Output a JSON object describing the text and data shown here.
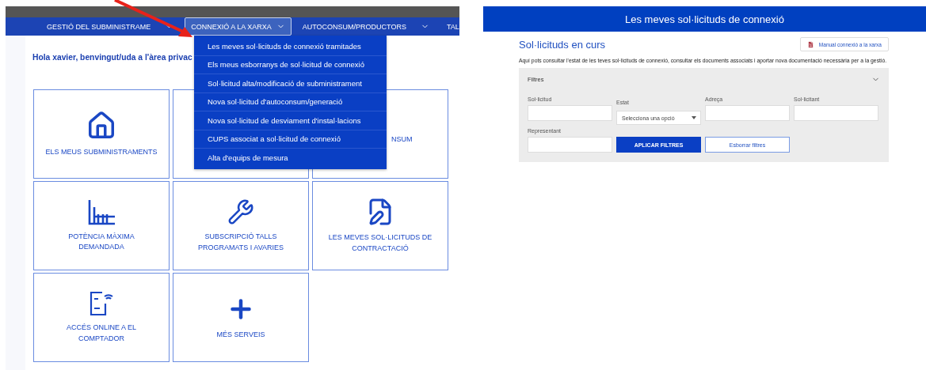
{
  "left_portal": {
    "nav": {
      "items": [
        {
          "label": "GESTIÓ DEL SUBMINISTRAME",
          "selected": false,
          "caret": true
        },
        {
          "label": "CONNEXIÓ A LA XARXA",
          "selected": true,
          "caret": true
        },
        {
          "label": "AUTOCONSUM/PRODUCTORS",
          "selected": false,
          "caret": true
        },
        {
          "label": "TAL",
          "selected": false,
          "caret": false
        }
      ]
    },
    "dropdown": {
      "items": [
        "Les meves sol·licituds de connexió tramitades",
        "Els meus esborranys de sol·licitud de connexió",
        "Sol·licitud alta/modificació de subministrament",
        "Nova sol·licitud d'autoconsum/generació",
        "Nova sol·licitud de desviament d'instal·lacions",
        "CUPS associat a sol·licitud de connexió",
        "Alta d'equips de mesura"
      ]
    },
    "greeting": "Hola xavier, benvingut/uda a l'àrea privac",
    "tiles": [
      {
        "kind": "full",
        "label": "ELS MEUS SUBMINISTRAMENTS"
      },
      {
        "kind": "covered"
      },
      {
        "kind": "partial",
        "label": "NSUM"
      },
      {
        "kind": "full",
        "label": "POTÈNCIA MÀXIMA DEMANDADA"
      },
      {
        "kind": "full",
        "label": "SUBSCRIPCIÓ TALLS PROGRAMATS I AVARIES"
      },
      {
        "kind": "full",
        "label": "LES MEVES SOL·LICITUDS DE CONTRACTACIÓ"
      },
      {
        "kind": "full",
        "label": "ACCÉS ONLINE A EL COMPTADOR"
      },
      {
        "kind": "full",
        "label": "MÉS SERVEIS"
      }
    ]
  },
  "right_page": {
    "header": "Les meves sol·licituds de connexió",
    "title": "Sol·licituds en curs",
    "manual_button": "Manual connexió a la xarxa",
    "description": "Aquí pots consultar l'estat de les teves sol·licituds de connexió, consultar els documents associats i aportar nova documentació necessària per a la gestió.",
    "filters": {
      "title": "Filtres",
      "expanded": true,
      "fields": [
        {
          "kind": "input",
          "label": "Sol·licitud"
        },
        {
          "kind": "select",
          "label": "Estat",
          "placeholder": "Selecciona una opció"
        },
        {
          "kind": "input",
          "label": "Adreça"
        },
        {
          "kind": "input",
          "label": "Sol·licitant"
        },
        {
          "kind": "input",
          "label": "Representant"
        }
      ],
      "apply_button": "APLICAR FILTRES",
      "clear_button": "Esborrar filtres"
    }
  }
}
